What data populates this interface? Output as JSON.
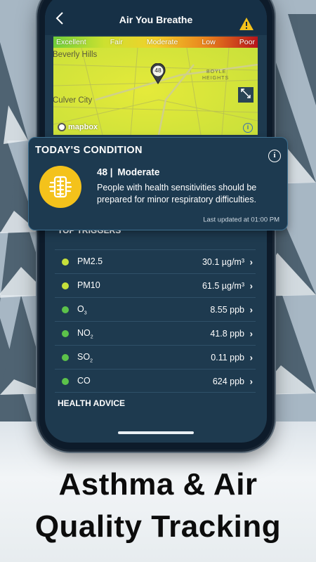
{
  "header": {
    "title": "Air You Breathe",
    "back_icon": "chevron-left-icon",
    "alert_icon": "warning-icon"
  },
  "map": {
    "scale": [
      "Excellent",
      "Fair",
      "Moderate",
      "Low",
      "Poor"
    ],
    "labels": [
      "Beverly Hills",
      "Culver City",
      "BOYLE",
      "HEIGHTS"
    ],
    "pin_value": "48",
    "attribution": "mapbox",
    "expand_icon": "expand-icon",
    "info_icon": "info-icon"
  },
  "condition": {
    "title": "TODAY'S CONDITION",
    "aqi": "48",
    "separator": "|",
    "level": "Moderate",
    "description": "People with health sensitivities should be prepared for minor respiratory difficulties.",
    "updated": "Last updated at 01:00 PM",
    "icon": "lungs-icon",
    "badge_color": "#f4c21b"
  },
  "triggers": {
    "title": "TOP TRIGGERS",
    "items": [
      {
        "name": "PM2.5",
        "sub": "",
        "value": "30.1 µg/m³",
        "color": "#c6e03b"
      },
      {
        "name": "PM10",
        "sub": "",
        "value": "61.5 µg/m³",
        "color": "#c6e03b"
      },
      {
        "name": "O",
        "sub": "3",
        "value": "8.55 ppb",
        "color": "#5cc24a"
      },
      {
        "name": "NO",
        "sub": "2",
        "value": "41.8 ppb",
        "color": "#5cc24a"
      },
      {
        "name": "SO",
        "sub": "2",
        "value": "0.11 ppb",
        "color": "#5cc24a"
      },
      {
        "name": "CO",
        "sub": "",
        "value": "624 ppb",
        "color": "#5cc24a"
      }
    ]
  },
  "health": {
    "title": "HEALTH ADVICE"
  },
  "tagline": {
    "line1": "Asthma & Air",
    "line2": "Quality Tracking"
  }
}
